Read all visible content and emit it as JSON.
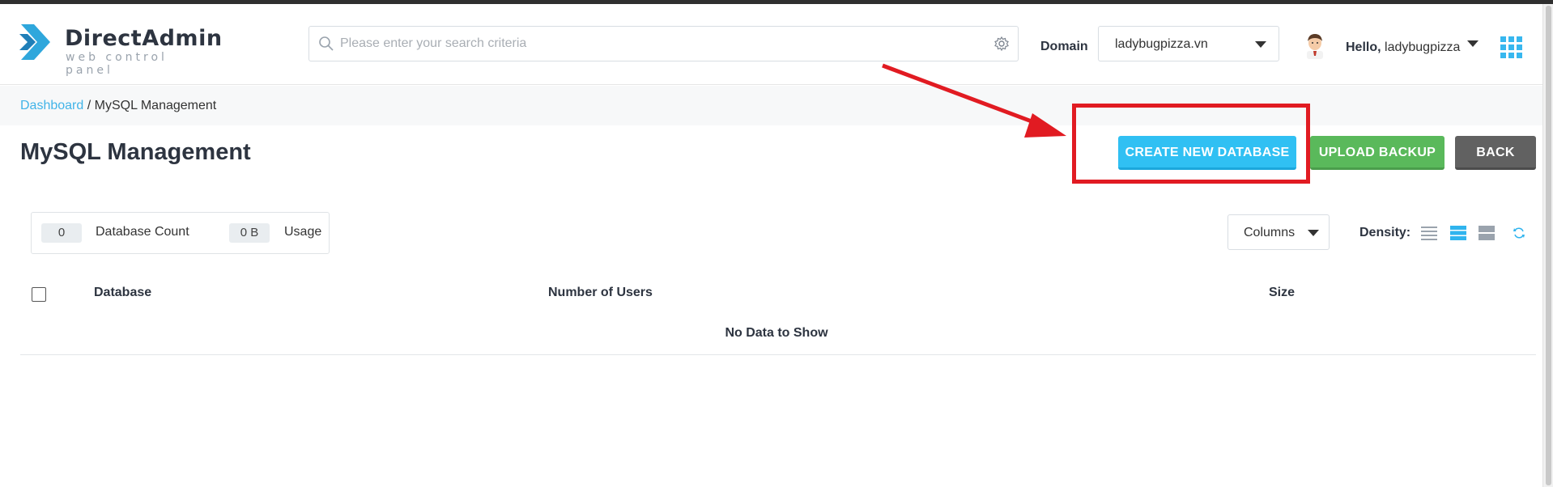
{
  "brand": {
    "name": "DirectAdmin",
    "tagline": "web control panel",
    "icon": "directadmin-chevron-logo"
  },
  "search": {
    "placeholder": "Please enter your search criteria",
    "value": ""
  },
  "domain": {
    "label": "Domain",
    "selected": "ladybugpizza.vn"
  },
  "user": {
    "greeting": "Hello,",
    "username": "ladybugpizza"
  },
  "breadcrumb": {
    "home": "Dashboard",
    "separator": "/",
    "current": "MySQL Management"
  },
  "page": {
    "title": "MySQL Management"
  },
  "actions": {
    "create_label": "CREATE NEW DATABASE",
    "upload_label": "UPLOAD BACKUP",
    "back_label": "BACK"
  },
  "stats": {
    "database_count_value": "0",
    "database_count_label": "Database Count",
    "usage_value": "0 B",
    "usage_label": "Usage"
  },
  "table": {
    "columns_button": "Columns",
    "density_label": "Density:",
    "density_selected": "medium",
    "headers": [
      "Database",
      "Number of Users",
      "Size"
    ],
    "empty_message": "No Data to Show"
  },
  "annotation": {
    "highlight_color": "#e11b22",
    "target": "create-database-button"
  },
  "colors": {
    "accent": "#30c0f3",
    "success": "#5ab95b",
    "neutral": "#616161",
    "link": "#42b4e8"
  }
}
